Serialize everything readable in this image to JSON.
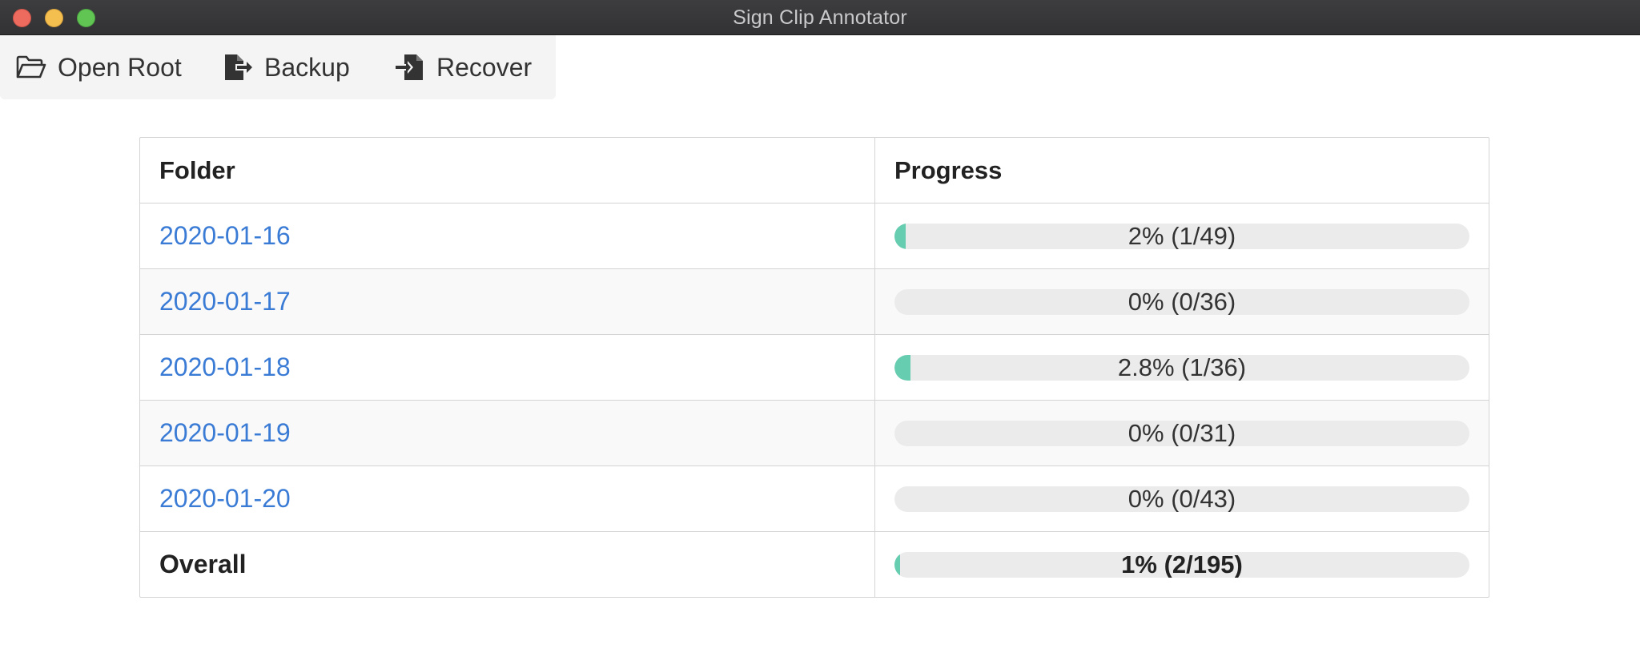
{
  "window": {
    "title": "Sign Clip Annotator"
  },
  "toolbar": {
    "open_root_label": "Open Root",
    "backup_label": "Backup",
    "recover_label": "Recover"
  },
  "table": {
    "headers": {
      "folder": "Folder",
      "progress": "Progress"
    },
    "rows": [
      {
        "folder": "2020-01-16",
        "progress_text": "2% (1/49)",
        "progress_fraction": 0.02
      },
      {
        "folder": "2020-01-17",
        "progress_text": "0% (0/36)",
        "progress_fraction": 0.0
      },
      {
        "folder": "2020-01-18",
        "progress_text": "2.8% (1/36)",
        "progress_fraction": 0.028
      },
      {
        "folder": "2020-01-19",
        "progress_text": "0% (0/31)",
        "progress_fraction": 0.0
      },
      {
        "folder": "2020-01-20",
        "progress_text": "0% (0/43)",
        "progress_fraction": 0.0
      }
    ],
    "overall": {
      "label": "Overall",
      "progress_text": "1% (2/195)",
      "progress_fraction": 0.01
    }
  },
  "colors": {
    "progress_fill": "#66cdb0",
    "progress_track": "#ebebeb",
    "link": "#3a7bd5"
  },
  "icons": {
    "open_root": "folder-open-icon",
    "backup": "file-export-icon",
    "recover": "file-import-icon"
  }
}
